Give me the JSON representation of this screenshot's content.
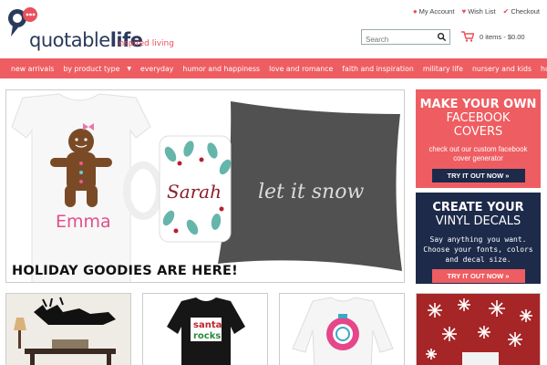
{
  "brand": {
    "logo_word_plain": "quotable",
    "logo_word_bold": "life",
    "tagline": "inspired living"
  },
  "account": {
    "my_account": "My Account",
    "wish_list": "Wish List",
    "checkout": "Checkout"
  },
  "search": {
    "placeholder": "Search"
  },
  "cart": {
    "summary": "0 items - $0.00"
  },
  "nav": {
    "items": [
      {
        "label": "new arrivals"
      },
      {
        "label": "by product type"
      },
      {
        "label": "everyday"
      },
      {
        "label": "humor and happiness"
      },
      {
        "label": "love and romance"
      },
      {
        "label": "faith and inspiration"
      },
      {
        "label": "military life"
      },
      {
        "label": "nursery and kids"
      },
      {
        "label": "holiday"
      }
    ]
  },
  "hero": {
    "caption": "HOLIDAY GOODIES ARE HERE!",
    "onesie_name": "Emma",
    "mug_name": "Sarah",
    "pillow_text": "let it snow"
  },
  "promos": [
    {
      "title": "MAKE YOUR OWN",
      "title2": "FACEBOOK",
      "title3": "COVERS",
      "sub": "check out our custom facebook cover generator",
      "button": "TRY IT OUT NOW »"
    },
    {
      "title": "CREATE YOUR",
      "title2": "VINYL DECALS",
      "sub": "Say anything you want. Choose your fonts, colors and decal size.",
      "button": "TRY IT OUT NOW »"
    }
  ],
  "cards": {
    "shirt_text_1": "santa",
    "shirt_text_2": "rocks"
  },
  "colors": {
    "accent": "#ee5d61",
    "navy": "#1d2a4a"
  }
}
